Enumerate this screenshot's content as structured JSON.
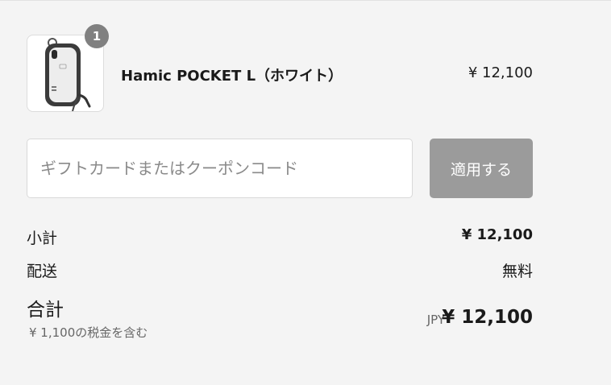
{
  "product": {
    "quantity": "1",
    "name": "Hamic POCKET L（ホワイト）",
    "price": "¥ 12,100",
    "image_icon": "phone-case-image"
  },
  "discount": {
    "placeholder": "ギフトカードまたはクーポンコード",
    "value": "",
    "apply_label": "適用する"
  },
  "summary": {
    "subtotal_label": "小計",
    "subtotal_value": "¥ 12,100",
    "shipping_label": "配送",
    "shipping_value": "無料",
    "total_label": "合計",
    "tax_note": "¥ 1,100の税金を含む",
    "currency": "JPY",
    "total_value": "¥ 12,100"
  },
  "colors": {
    "background": "#f4f4f4",
    "badge": "#808080",
    "apply_button_disabled": "#9b9b9b",
    "input_border": "#d9d9d9"
  }
}
